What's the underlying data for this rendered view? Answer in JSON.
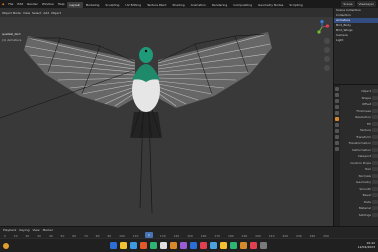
{
  "menu": {
    "logo": "◆",
    "items": [
      "File",
      "Edit",
      "Render",
      "Window",
      "Help"
    ],
    "tabs": [
      "Layout",
      "Modeling",
      "Sculpting",
      "UV Editing",
      "Texture Paint",
      "Shading",
      "Animation",
      "Rendering",
      "Compositing",
      "Geometry Nodes",
      "Scripting"
    ],
    "active_tab": "Layout",
    "right_items": [
      "Scene",
      "ViewLayer"
    ]
  },
  "viewport": {
    "header_items": [
      "Object Mode",
      "View",
      "Select",
      "Add",
      "Object"
    ],
    "object_label": "quetzal_bird",
    "object_sublabel": "(1) Armature",
    "gizmo_axes": {
      "x": "X",
      "y": "Y",
      "z": "Z"
    },
    "colors": {
      "x": "#e04050",
      "y": "#6fbf2f",
      "z": "#3a7de0"
    }
  },
  "outliner": {
    "rows": [
      "Scene Collection",
      "Collection",
      "Armature",
      "Bird_Body",
      "Bird_Wings",
      "Camera",
      "Light"
    ],
    "selected_index": 2
  },
  "properties": {
    "rows": [
      "Object",
      "Shape",
      "Offset",
      "Thickness",
      "Resolution",
      "Fill",
      "Texture",
      "Transform",
      "Transformation",
      "Deformation",
      "Viewport",
      "Custom Props",
      "Hair",
      "Normals",
      "Geometry",
      "Smooth",
      "Bevel",
      "Data",
      "Material",
      "Settings"
    ]
  },
  "timeline": {
    "controls": [
      "Playback",
      "Keying",
      "View",
      "Marker"
    ],
    "frames": [
      "0",
      "10",
      "20",
      "30",
      "40",
      "50",
      "60",
      "70",
      "80",
      "90",
      "100",
      "110",
      "120",
      "130",
      "140",
      "150",
      "160",
      "170",
      "180",
      "190",
      "200",
      "210",
      "220",
      "230",
      "240",
      "250"
    ],
    "current_frame": "1"
  },
  "taskbar": {
    "app_colors": [
      "#2b6fd6",
      "#f2c230",
      "#3c9be0",
      "#e05a2b",
      "#2bb673",
      "#e0e0e0",
      "#d88a2a",
      "#9a5cd6",
      "#2b6fd6",
      "#e04050",
      "#4aa3df",
      "#f2c230",
      "#2bb673",
      "#d88a2a",
      "#e04050",
      "#7a7a7a"
    ],
    "time": "10:42",
    "date": "12/04/2023"
  }
}
